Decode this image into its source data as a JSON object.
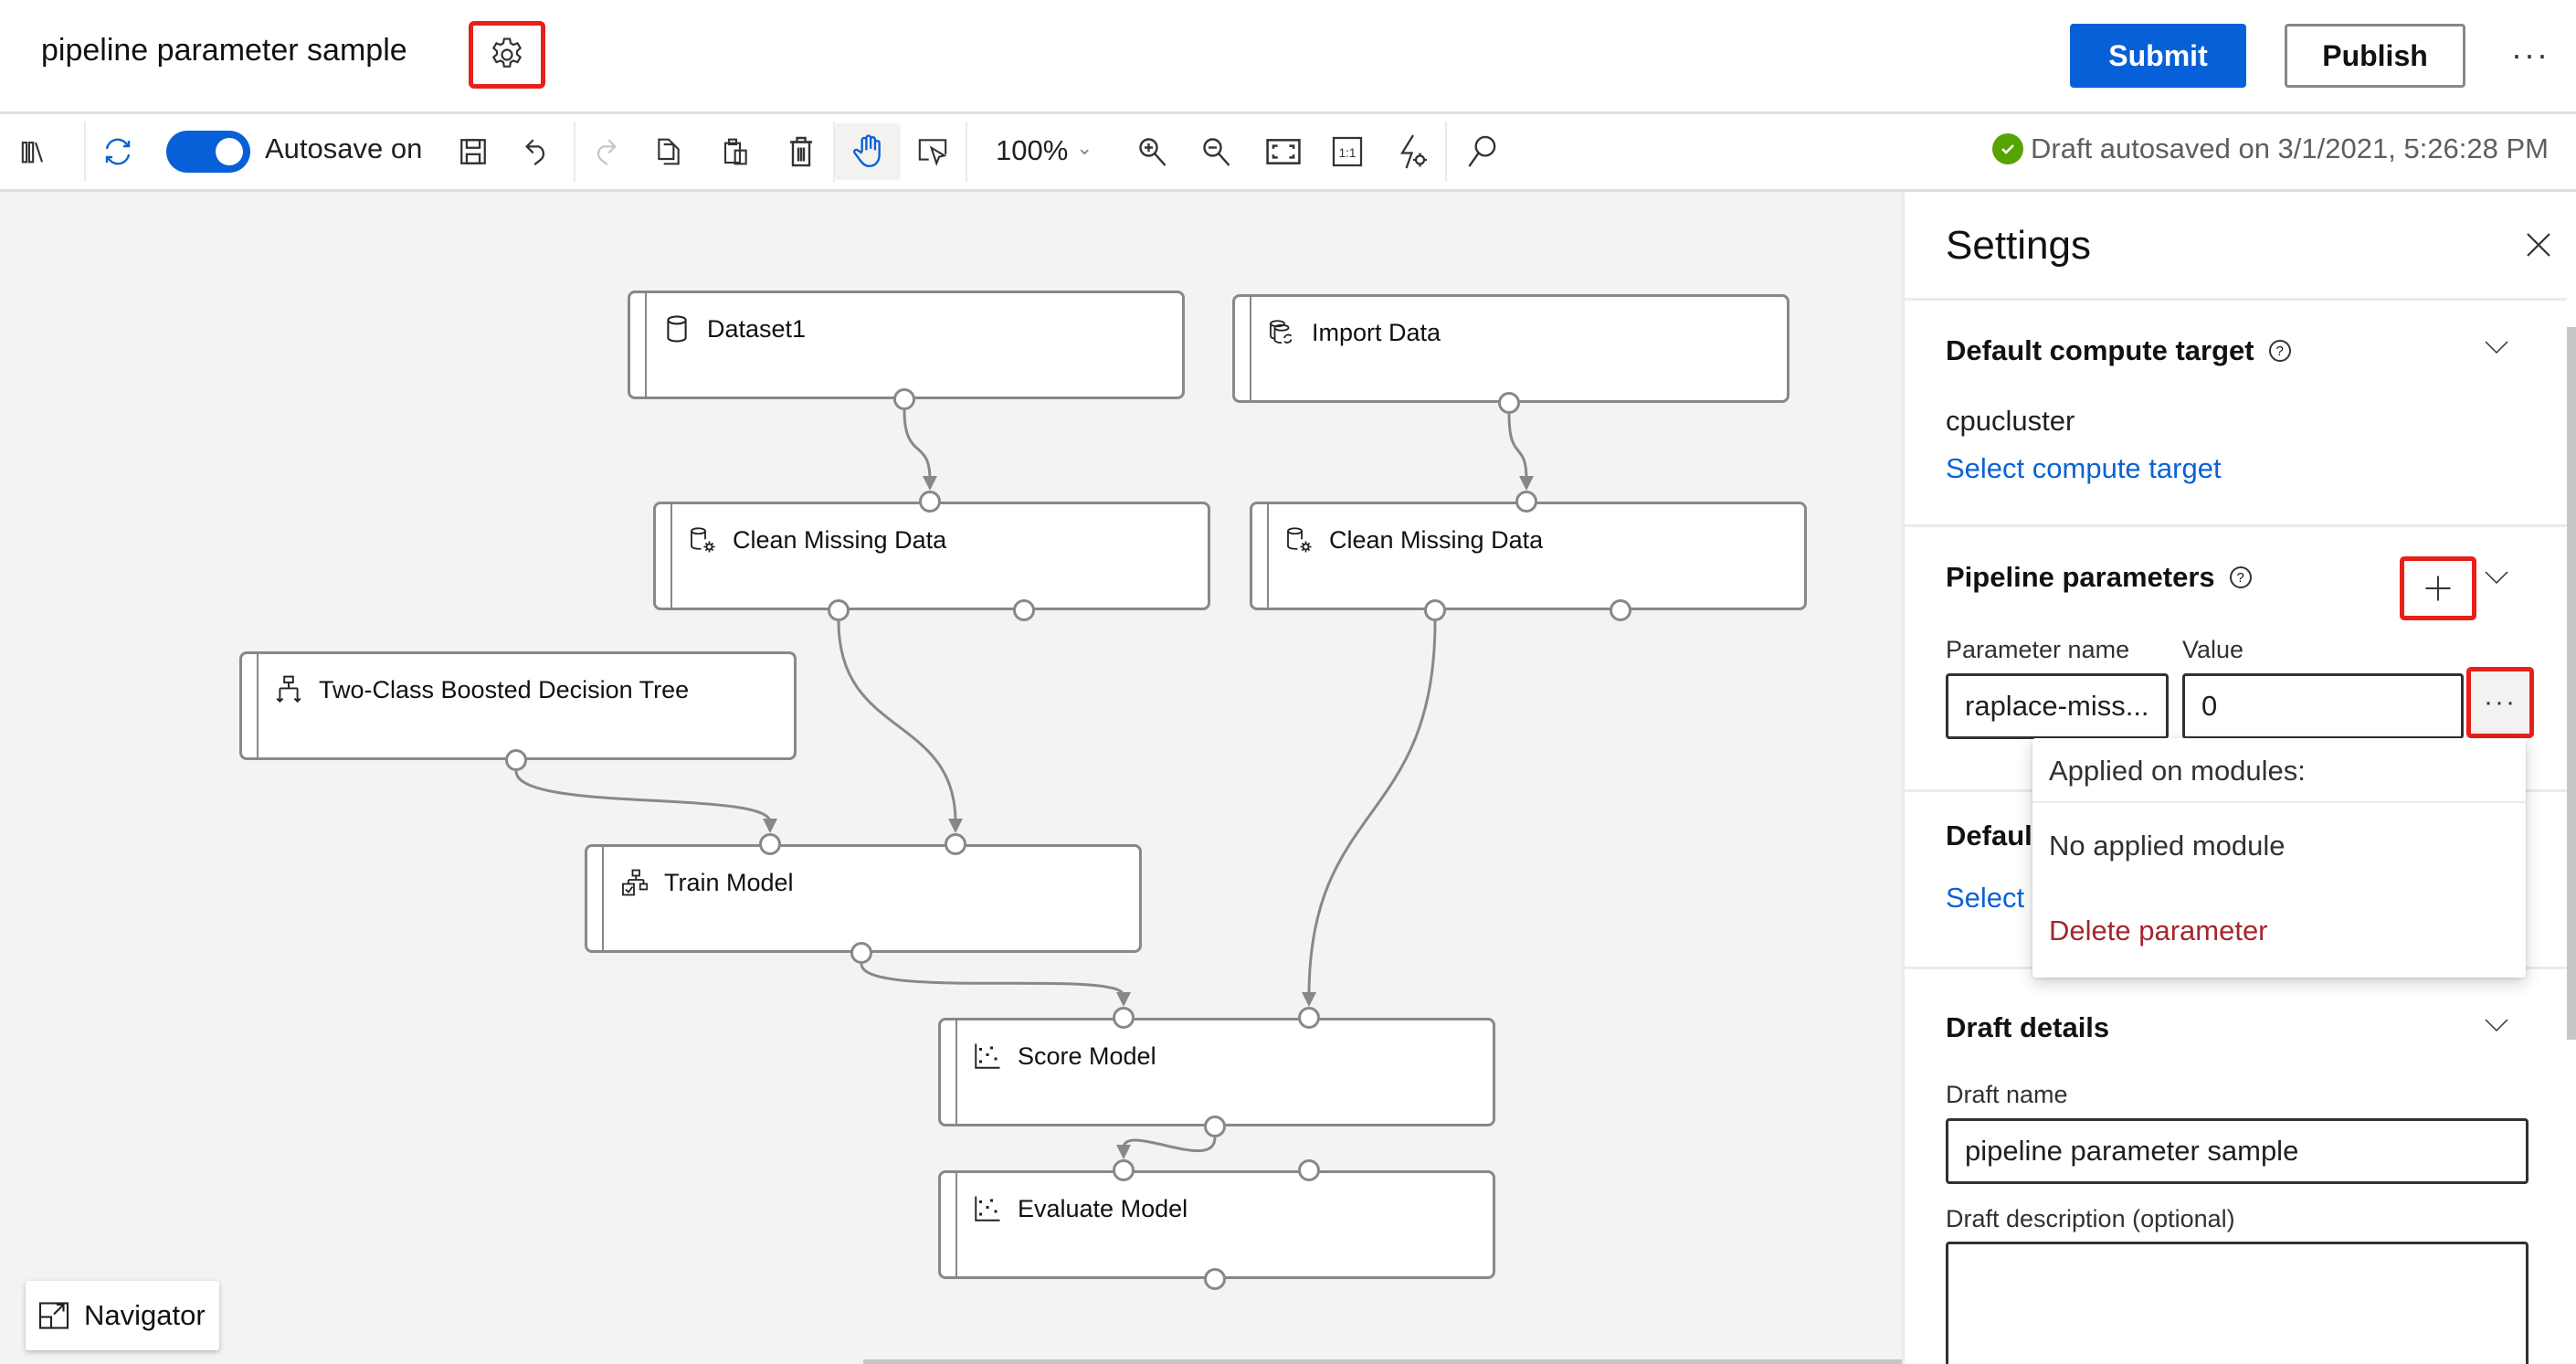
{
  "header": {
    "title": "pipeline parameter sample",
    "settings_icon": "gear-icon",
    "submit_label": "Submit",
    "publish_label": "Publish",
    "more_label": "···"
  },
  "toolbar": {
    "autosave_label": "Autosave on",
    "autosave_on": true,
    "zoom_level": "100%",
    "autosaved_status": "Draft autosaved on 3/1/2021, 5:26:28 PM",
    "icons": [
      "library-icon",
      "refresh-icon",
      "save-icon",
      "undo-icon",
      "redo-icon",
      "copy-icon",
      "paste-icon",
      "delete-icon",
      "pan-hand-icon",
      "select-pointer-icon",
      "zoom-in-icon",
      "zoom-out-icon",
      "fit-to-screen-icon",
      "actual-size-icon",
      "auto-layout-icon",
      "search-icon"
    ]
  },
  "canvas": {
    "nodes": [
      {
        "id": "dataset1",
        "label": "Dataset1",
        "icon": "dataset-icon"
      },
      {
        "id": "import-data",
        "label": "Import Data",
        "icon": "import-data-icon"
      },
      {
        "id": "clean-missing-1",
        "label": "Clean Missing Data",
        "icon": "clean-data-icon"
      },
      {
        "id": "clean-missing-2",
        "label": "Clean Missing Data",
        "icon": "clean-data-icon"
      },
      {
        "id": "two-class-bdt",
        "label": "Two-Class Boosted Decision Tree",
        "icon": "decision-tree-icon"
      },
      {
        "id": "train-model",
        "label": "Train Model",
        "icon": "train-model-icon"
      },
      {
        "id": "score-model",
        "label": "Score Model",
        "icon": "scatter-icon"
      },
      {
        "id": "evaluate-model",
        "label": "Evaluate Model",
        "icon": "scatter-icon"
      }
    ],
    "edges": [
      [
        "dataset1",
        "clean-missing-1"
      ],
      [
        "import-data",
        "clean-missing-2"
      ],
      [
        "two-class-bdt",
        "train-model"
      ],
      [
        "clean-missing-1",
        "train-model"
      ],
      [
        "train-model",
        "score-model"
      ],
      [
        "clean-missing-2",
        "score-model"
      ],
      [
        "score-model",
        "evaluate-model"
      ]
    ],
    "navigator_label": "Navigator"
  },
  "settings": {
    "title": "Settings",
    "compute": {
      "title": "Default compute target",
      "value": "cpucluster",
      "link": "Select compute target"
    },
    "pipeline_params": {
      "title": "Pipeline parameters",
      "name_label": "Parameter name",
      "value_label": "Value",
      "params": [
        {
          "name": "raplace-miss...",
          "value": "0"
        }
      ]
    },
    "default_datastore": {
      "title_partial": "Default",
      "link_partial": "Select"
    },
    "popup": {
      "header": "Applied on modules:",
      "empty": "No applied module",
      "delete": "Delete parameter"
    },
    "draft": {
      "title": "Draft details",
      "name_label": "Draft name",
      "name_value": "pipeline parameter sample",
      "desc_label": "Draft description (optional)",
      "desc_value": ""
    }
  }
}
